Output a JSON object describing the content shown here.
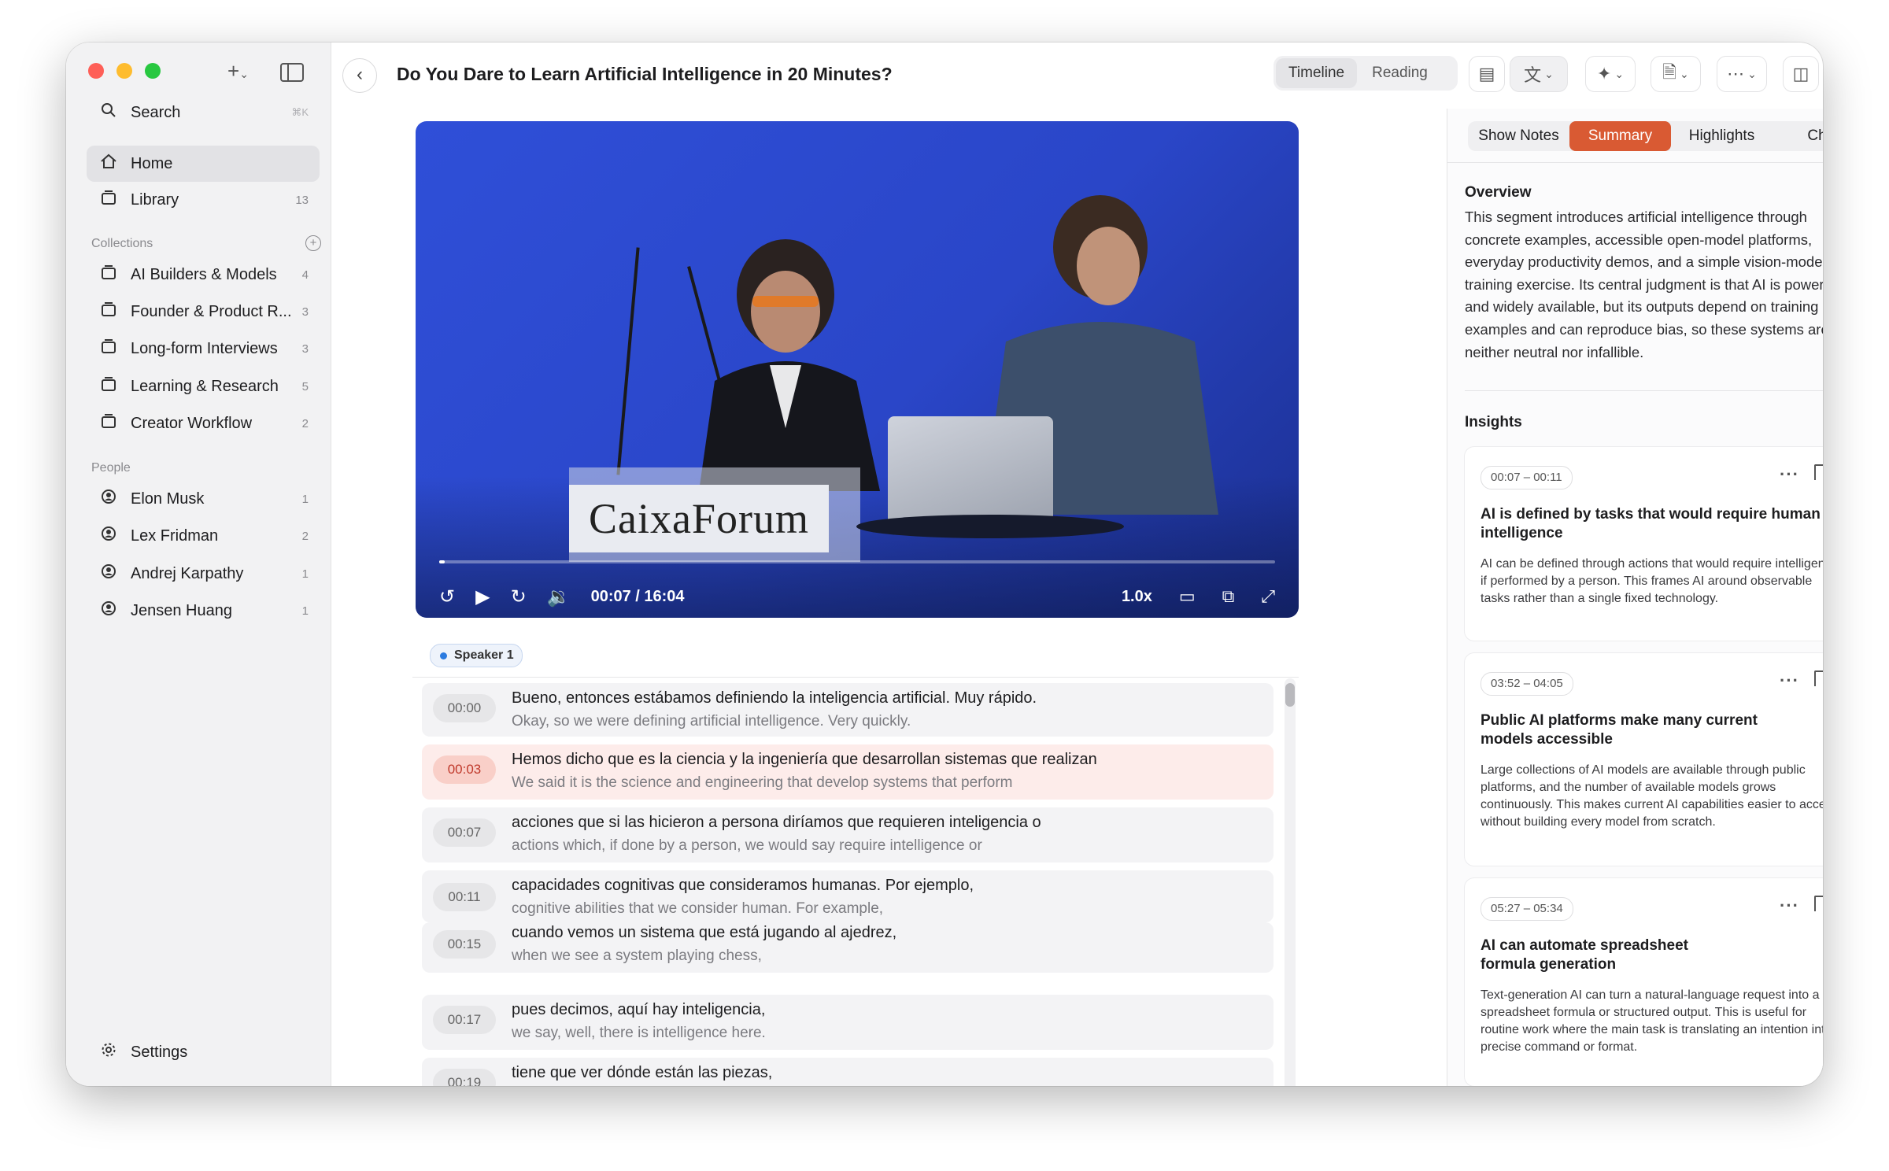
{
  "sidebar": {
    "search_label": "Search",
    "search_shortcut": "⌘K",
    "items": [
      {
        "label": "Home"
      },
      {
        "label": "Library",
        "count": "13"
      }
    ],
    "collections_title": "Collections",
    "collections": [
      {
        "label": "AI Builders & Models",
        "count": "4"
      },
      {
        "label": "Founder & Product R...",
        "count": "3"
      },
      {
        "label": "Long-form Interviews",
        "count": "3"
      },
      {
        "label": "Learning & Research",
        "count": "5"
      },
      {
        "label": "Creator Workflow",
        "count": "2"
      }
    ],
    "people_title": "People",
    "people": [
      {
        "label": "Elon Musk",
        "count": "1"
      },
      {
        "label": "Lex Fridman",
        "count": "2"
      },
      {
        "label": "Andrej Karpathy",
        "count": "1"
      },
      {
        "label": "Jensen Huang",
        "count": "1"
      }
    ],
    "settings_label": "Settings"
  },
  "header": {
    "title": "Do You Dare to Learn Artificial Intelligence in 20 Minutes?",
    "view_timeline": "Timeline",
    "view_reading": "Reading"
  },
  "video": {
    "sign_text": "CaixaForum",
    "time": "00:07 / 16:04",
    "speed": "1.0x",
    "progress_fraction": 0.007
  },
  "transcript": {
    "speaker": "Speaker 1",
    "segments": [
      {
        "ts": "00:00",
        "orig": "Bueno, entonces estábamos definiendo la inteligencia artificial. Muy rápido.",
        "trans": "Okay, so we were defining artificial intelligence. Very quickly."
      },
      {
        "ts": "00:03",
        "orig": "Hemos dicho que es la ciencia y la ingeniería que desarrollan sistemas que realizan",
        "trans": "We said it is the science and engineering that develop systems that perform"
      },
      {
        "ts": "00:07",
        "orig": "acciones que si las hicieron a persona diríamos que requieren inteligencia o",
        "trans": "actions which, if done by a person, we would say require intelligence or"
      },
      {
        "ts": "00:11",
        "orig": "capacidades cognitivas que consideramos humanas. Por ejemplo,",
        "trans": "cognitive abilities that we consider human. For example,"
      },
      {
        "ts": "00:15",
        "orig": "cuando vemos un sistema que está jugando al ajedrez,",
        "trans": "when we see a system playing chess,"
      },
      {
        "ts": "00:17",
        "orig": "pues decimos, aquí hay inteligencia,",
        "trans": "we say, well, there is intelligence here."
      },
      {
        "ts": "00:19",
        "orig": "tiene que ver dónde están las piezas,",
        "trans": ""
      }
    ]
  },
  "panel": {
    "tabs": [
      "Show Notes",
      "Summary",
      "Highlights",
      "Chat"
    ],
    "overview_title": "Overview",
    "overview_text": "This segment introduces artificial intelligence through concrete examples, accessible open-model platforms, everyday productivity demos, and a simple vision-model training exercise. Its central judgment is that AI is powerful and widely available, but its outputs depend on training examples and can reproduce bias, so these systems are neither neutral nor infallible.",
    "insights_title": "Insights",
    "insights": [
      {
        "range": "00:07 – 00:11",
        "title": "AI is defined by tasks that would require human intelligence",
        "body": "AI can be defined through actions that would require intelligence if performed by a person. This frames AI around observable tasks rather than a single fixed technology."
      },
      {
        "range": "03:52 – 04:05",
        "title": "Public AI platforms make many current models accessible",
        "body": "Large collections of AI models are available through public platforms, and the number of available models grows continuously. This makes current AI capabilities easier to access without building every model from scratch."
      },
      {
        "range": "05:27 – 05:34",
        "title": "AI can automate spreadsheet formula generation",
        "body": "Text-generation AI can turn a natural-language request into a spreadsheet formula or structured output. This is useful for routine work where the main task is translating an intention into a precise command or format."
      }
    ]
  }
}
